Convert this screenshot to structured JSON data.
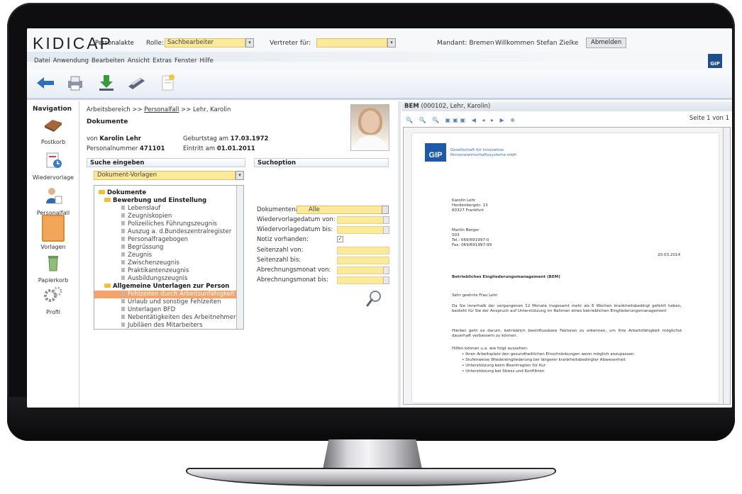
{
  "header": {
    "logo": "KIDICAP",
    "app_title": "Personalakte",
    "rolle_label": "Rolle:",
    "rolle_value": "Sachbearbeiter",
    "vertreter_label": "Vertreter für:",
    "vertreter_value": "",
    "mandant": "Mandant: Bremen",
    "welcome": "Willkommen Stefan Zielke",
    "logout": "Abmelden",
    "brand_small": "GIP"
  },
  "menu": [
    "Datei",
    "Anwendung",
    "Bearbeiten",
    "Ansicht",
    "Extras",
    "Fenster",
    "Hilfe"
  ],
  "toolbar_icons": [
    "back-arrow-icon",
    "print-icon",
    "download-icon",
    "scan-icon",
    "new-document-icon"
  ],
  "nav": {
    "title": "Navigation",
    "items": [
      {
        "label": "Postkorb",
        "icon": "inbox-tray-icon"
      },
      {
        "label": "Wiedervorlage",
        "icon": "resubmission-icon"
      },
      {
        "label": "Personalfall",
        "icon": "person-icon"
      },
      {
        "label": "Vorlagen",
        "icon": "template-icon"
      },
      {
        "label": "Papierkorb",
        "icon": "trash-icon"
      },
      {
        "label": "Profil",
        "icon": "gears-icon"
      }
    ]
  },
  "center": {
    "breadcrumb_prefix": "Arbeitsbereich >> ",
    "breadcrumb_link": "Personalfall",
    "breadcrumb_suffix": " >> Lehr, Karolin",
    "title": "Dokumente",
    "von_label": "von",
    "person_name": "Karolin Lehr",
    "pnr_label": "Personalnummer",
    "pnr": "471101",
    "birthday_label": "Geburtstag am",
    "birthday": "17.03.1972",
    "entry_label": "Eintritt am",
    "entry": "01.01.2011",
    "search_header": "Suche eingeben",
    "search_select": "Dokument-Vorlagen",
    "tree": [
      {
        "label": "Dokumente",
        "level": 0,
        "folder": true
      },
      {
        "label": "Bewerbung und Einstellung",
        "level": 1,
        "folder": true
      },
      {
        "label": "Lebenslauf",
        "level": 2
      },
      {
        "label": "Zeugniskopien",
        "level": 2
      },
      {
        "label": "Polizeiliches Führungszeugnis",
        "level": 2
      },
      {
        "label": "Auszug a. d.Bundeszentralregister",
        "level": 2
      },
      {
        "label": "Personalfragebogen",
        "level": 2
      },
      {
        "label": "Begrüssung",
        "level": 2
      },
      {
        "label": "Zeugnis",
        "level": 2
      },
      {
        "label": "Zwischenzeugnis",
        "level": 2
      },
      {
        "label": "Praktikantenzeugnis",
        "level": 2
      },
      {
        "label": "Ausbildungszeugnis",
        "level": 2
      },
      {
        "label": "Allgemeine Unterlagen zur Person",
        "level": 1,
        "folder": true
      },
      {
        "label": "Fehlzeiten durch Arbeitsunfähigkeit",
        "level": 2,
        "selected": true
      },
      {
        "label": "Urlaub und sonstige Fehlzeiten",
        "level": 2
      },
      {
        "label": "Unterlagen BFD",
        "level": 2
      },
      {
        "label": "Nebentätigkeiten des Arbeitnehmer",
        "level": 2
      },
      {
        "label": "Jubiläen des Mitarbeiters",
        "level": 2
      }
    ],
    "options_header": "Suchoption",
    "options": {
      "art_label": "Dokumentenart:",
      "art_value": "Alle",
      "wv_von": "Wiedervorlagedatum von:",
      "wv_bis": "Wiedervorlagedatum bis:",
      "notiz": "Notiz vorhanden:",
      "notiz_check": "✓",
      "seite_von": "Seitenzahl von:",
      "seite_bis": "Seitenzahl bis:",
      "abr_von": "Abrechnungsmonat von:",
      "abr_bis": "Abrechnungsmonat bis:"
    }
  },
  "preview": {
    "title_bold": "BEM",
    "title_rest": " (000102, Lehr, Karolin)",
    "tools": "🔍 🔍 🔍  ▣▣▣  ◀ ◂ ▸ ▶  ⊕",
    "page_info": "Seite 1 von 1",
    "doc": {
      "logo": "GIP",
      "company1": "Gesellschaft für innovative",
      "company2": "Personalwirtschaftssysteme mbH",
      "addr1": "Karolin Lehr",
      "addr2": "Herdenbergstr. 13",
      "addr3": "60327 Frankfurt",
      "sender1": "Martin Berger",
      "sender2": "S03",
      "sender3": "Tel.: 069/691997-0",
      "sender4": "Fax: 069/691997-99",
      "date": "20.03.2014",
      "subject": "Betriebliches Eingliederungsmanagement (BEM)",
      "salutation": "Sehr geehrte Frau Lehr",
      "p1": "Da Sie innerhalb der vergangenen 12 Monate insgesamt mehr als 6 Wochen krankheitsbedingt gefehlt haben, besteht für Sie der Anspruch auf Unterstützung im Rahmen eines betrieblichen Eingliederungsmanagement",
      "p2": "Hierbei geht es darum, betrieblich beeinflussbare Faktoren zu erkennen, um Ihre Arbeitsfähigkeit möglichst dauerhaft verbessern zu können.",
      "p3": "Hilfen können u.a. wie folgt aussehen:",
      "bullets": [
        "Ihren Arbeitsplatz den gesundheitlichen Einschränkungen wenn möglich anzupassen.",
        "Stufenweise Wiedereingliederung bei längerer krankheitsbedingter Abwesenheit",
        "Unterstützung beim Beantragten für Kur",
        "Unterstützung bei Stress und Konflikten"
      ]
    }
  },
  "colors": {
    "field_yellow": "#fce99a",
    "selection_orange": "#f5a36a",
    "accent_blue": "#1e5aa6"
  }
}
